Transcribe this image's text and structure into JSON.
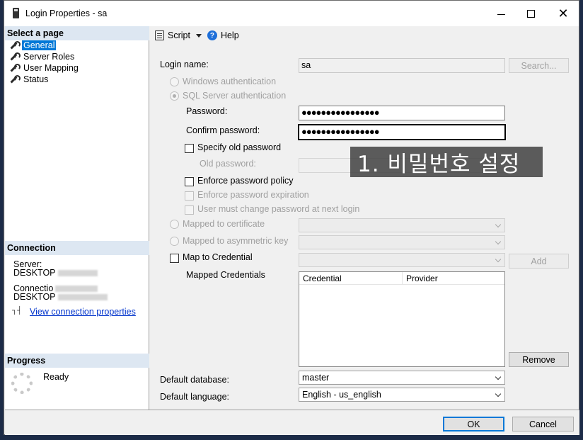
{
  "window": {
    "title": "Login Properties - sa"
  },
  "left": {
    "select_page_header": "Select a page",
    "pages": [
      "General",
      "Server Roles",
      "User Mapping",
      "Status"
    ],
    "connection_header": "Connection",
    "server_label": "Server:",
    "server_value": "DESKTOP",
    "connection_label": "Connectio",
    "connection_value": "DESKTOP",
    "view_connection_link": "View connection properties",
    "progress_header": "Progress",
    "progress_status": "Ready"
  },
  "toolbar": {
    "script_label": "Script",
    "help_label": "Help"
  },
  "form": {
    "login_name_label": "Login name:",
    "login_name_value": "sa",
    "search_button": "Search...",
    "windows_auth": "Windows authentication",
    "sql_auth": "SQL Server authentication",
    "password_label": "Password:",
    "password_value": "●●●●●●●●●●●●●●●●",
    "confirm_password_label": "Confirm password:",
    "confirm_password_value": "●●●●●●●●●●●●●●●●",
    "specify_old_password": "Specify old password",
    "old_password_label": "Old password:",
    "enforce_policy": "Enforce password policy",
    "enforce_expiration": "Enforce password expiration",
    "must_change": "User must change password at next login",
    "mapped_certificate": "Mapped to certificate",
    "mapped_asymmetric_key": "Mapped to asymmetric key",
    "map_to_credential": "Map to Credential",
    "add_button": "Add",
    "mapped_credentials_label": "Mapped Credentials",
    "grid_columns": [
      "Credential",
      "Provider"
    ],
    "remove_button": "Remove",
    "default_database_label": "Default database:",
    "default_database_value": "master",
    "default_language_label": "Default language:",
    "default_language_value": "English - us_english"
  },
  "annotation": {
    "text": "1. 비밀번호 설정"
  },
  "footer": {
    "ok_button": "OK",
    "cancel_button": "Cancel"
  }
}
